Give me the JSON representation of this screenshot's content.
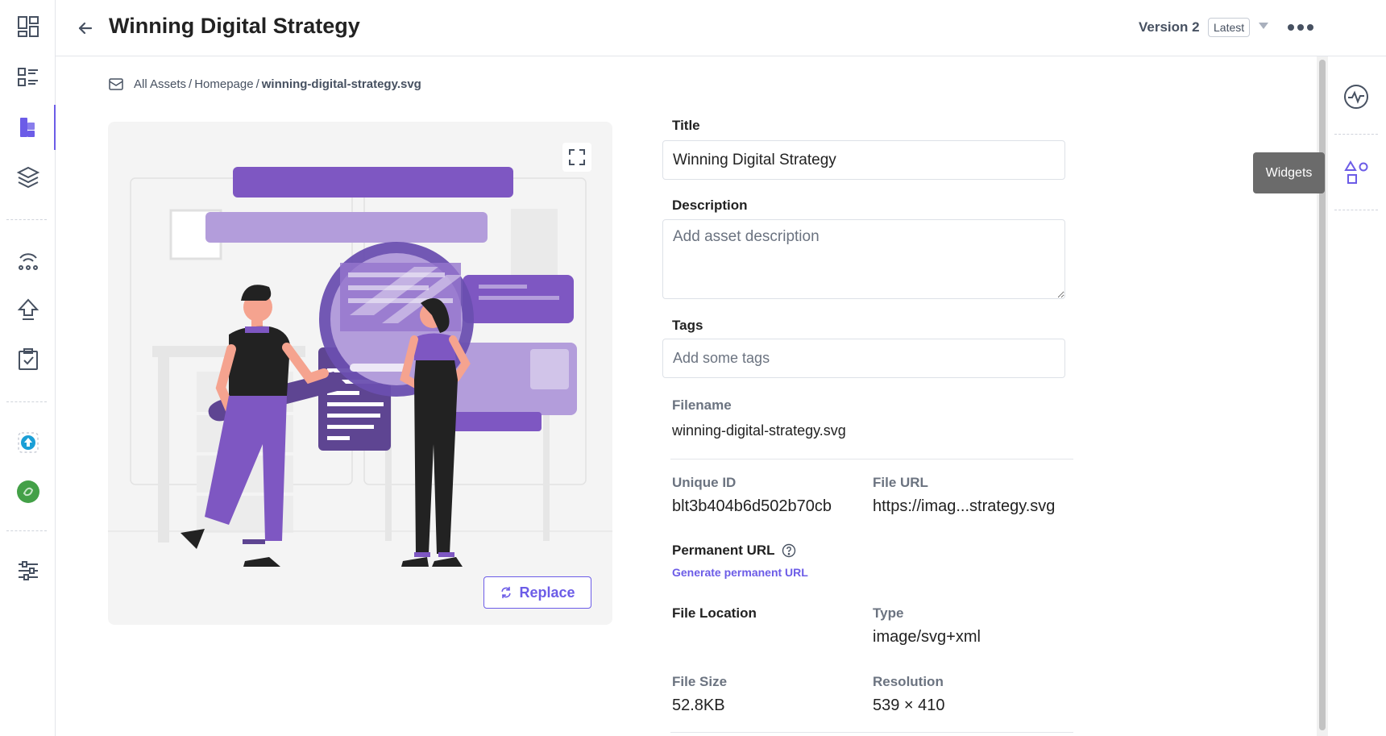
{
  "header": {
    "title": "Winning Digital Strategy",
    "version_label": "Version 2",
    "latest_badge": "Latest"
  },
  "breadcrumb": {
    "items": [
      "All Assets",
      "Homepage"
    ],
    "current": "winning-digital-strategy.svg"
  },
  "preview": {
    "replace_label": "Replace"
  },
  "form": {
    "title_label": "Title",
    "title_value": "Winning Digital Strategy",
    "description_label": "Description",
    "description_placeholder": "Add asset description",
    "tags_label": "Tags",
    "tags_placeholder": "Add some tags",
    "filename_label": "Filename",
    "filename_value": "winning-digital-strategy.svg",
    "unique_id_label": "Unique ID",
    "unique_id_value": "blt3b404b6d502b70cb",
    "file_url_label": "File URL",
    "file_url_value": "https://imag...strategy.svg",
    "permanent_url_label": "Permanent URL",
    "generate_link": "Generate permanent URL",
    "file_location_label": "File Location",
    "type_label": "Type",
    "type_value": "image/svg+xml",
    "file_size_label": "File Size",
    "file_size_value": "52.8KB",
    "resolution_label": "Resolution",
    "resolution_value": "539 × 410"
  },
  "right_rail": {
    "tooltip": "Widgets"
  },
  "colors": {
    "accent": "#6c5ce7",
    "illustration_purple": "#7e57c2",
    "nav_icon": "#475161"
  },
  "icons": {
    "left_nav": [
      "dashboard-icon",
      "entries-icon",
      "assets-icon",
      "stack-icon",
      "releases-icon",
      "publish-icon",
      "tasks-icon",
      "upload-app-icon",
      "app-icon",
      "settings-icon"
    ],
    "right_rail": [
      "activity-icon",
      "widgets-icon"
    ]
  }
}
